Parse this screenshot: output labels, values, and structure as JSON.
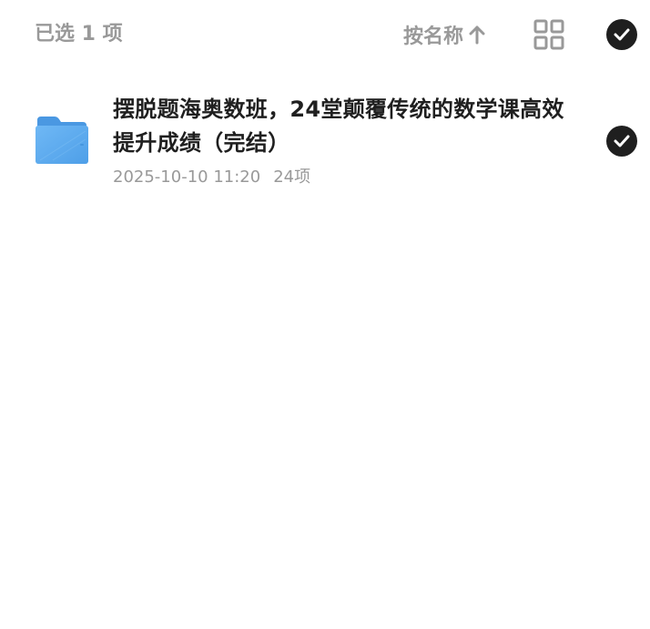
{
  "header": {
    "selected_label": "已选 1 项",
    "sort_label": "按名称",
    "sort_icon": "arrow-up-icon",
    "view_icon": "grid-view-icon",
    "select_all_icon": "check-circle-icon"
  },
  "files": [
    {
      "name": "摆脱题海奥数班，24堂颠覆传统的数学课高效提升成绩（完结）",
      "date": "2025-10-10 11:20",
      "count": "24项",
      "icon": "folder-icon",
      "selected": true
    }
  ],
  "colors": {
    "text_primary": "#1f1f1f",
    "text_secondary": "#999999",
    "check_bg": "#1f1f1f",
    "folder_blue": "#5aaaf0"
  }
}
